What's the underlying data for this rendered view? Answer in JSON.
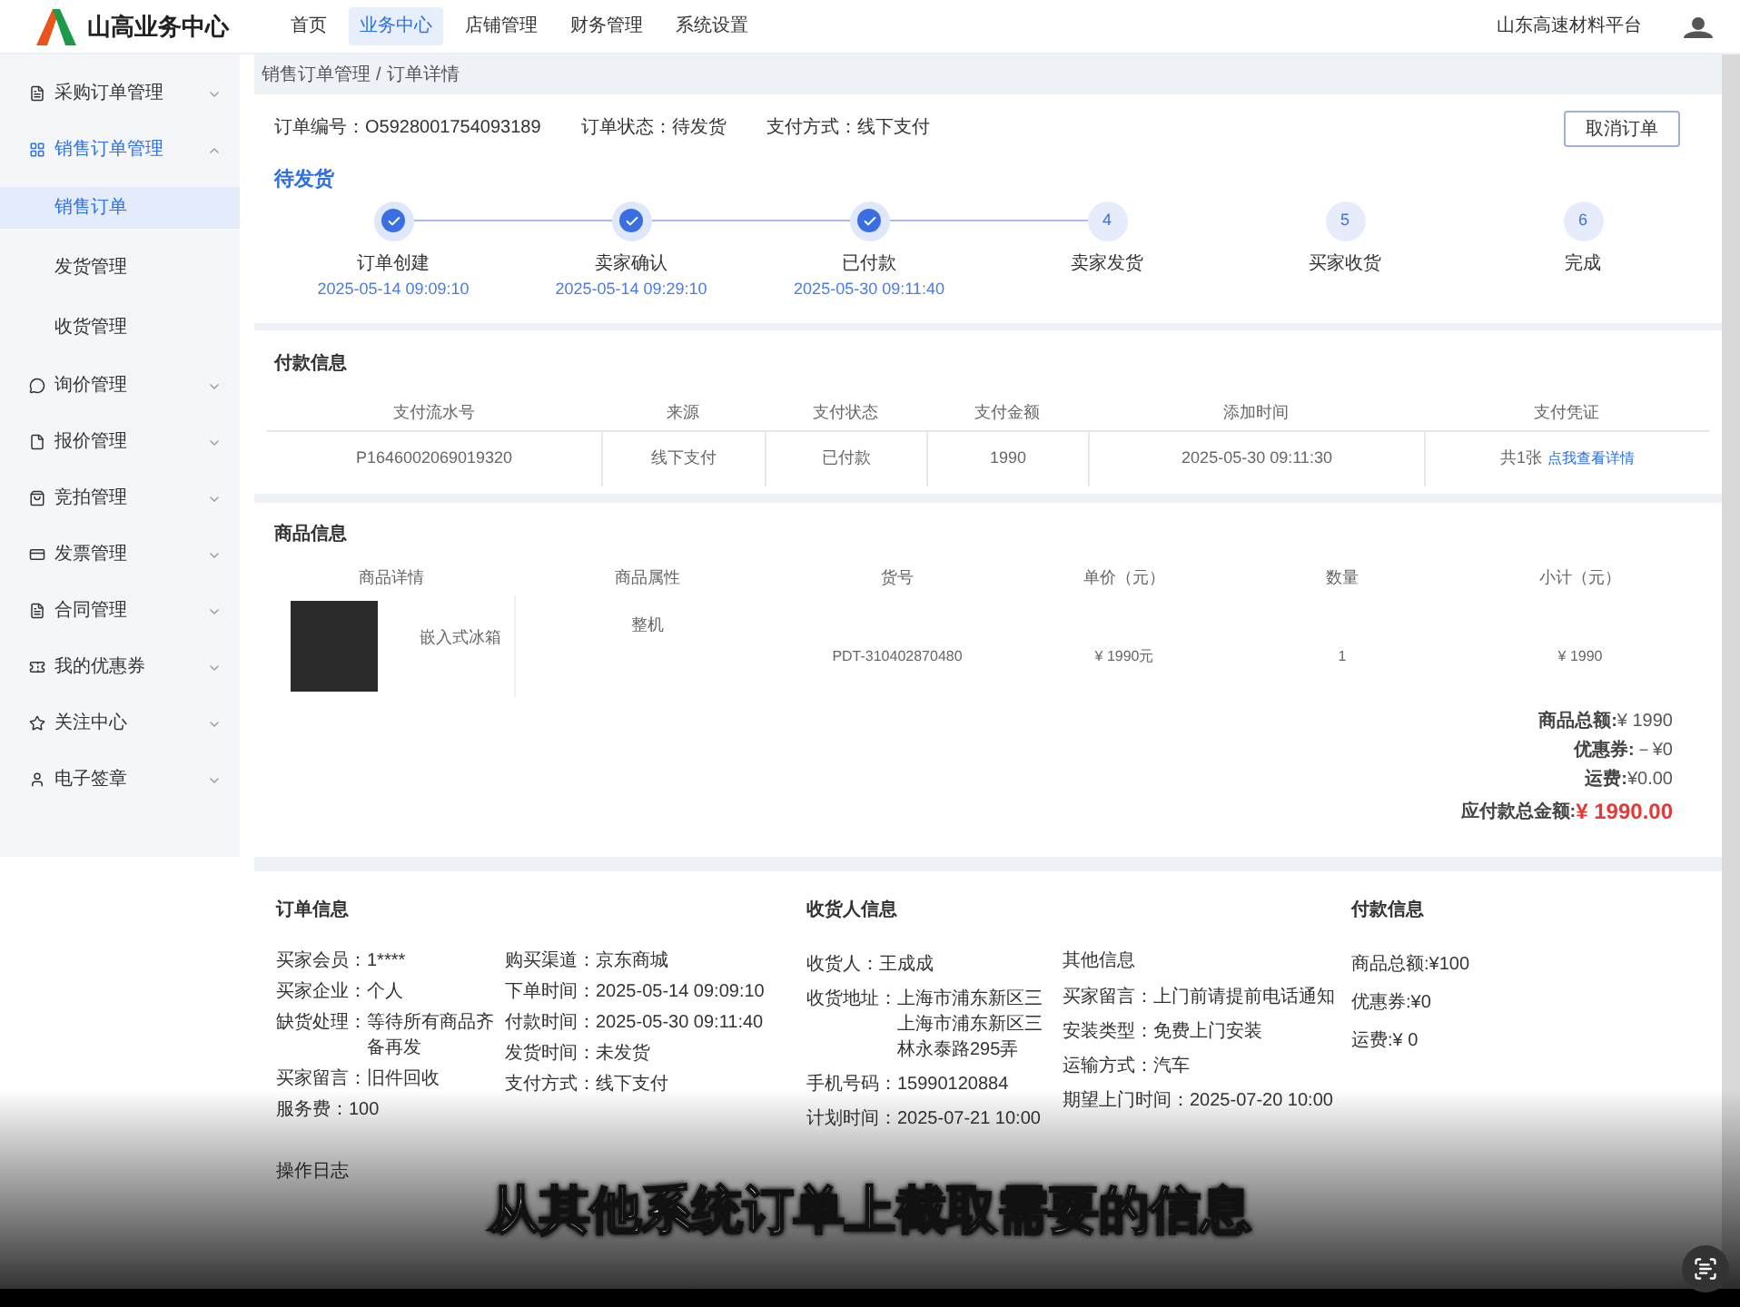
{
  "header": {
    "title": "山高业务中心",
    "nav": [
      {
        "label": "首页",
        "selected": false
      },
      {
        "label": "业务中心",
        "selected": true
      },
      {
        "label": "店铺管理",
        "selected": false
      },
      {
        "label": "财务管理",
        "selected": false
      },
      {
        "label": "系统设置",
        "selected": false
      }
    ],
    "platform": "山东高速材料平台"
  },
  "sidebar": {
    "items": [
      {
        "label": "采购订单管理",
        "selected": false,
        "expanded": false
      },
      {
        "label": "销售订单管理",
        "selected": true,
        "expanded": true,
        "children": [
          {
            "label": "销售订单",
            "selected": true
          },
          {
            "label": "发货管理",
            "selected": false
          },
          {
            "label": "收货管理",
            "selected": false
          }
        ]
      },
      {
        "label": "询价管理",
        "selected": false,
        "expanded": false
      },
      {
        "label": "报价管理",
        "selected": false,
        "expanded": false
      },
      {
        "label": "竞拍管理",
        "selected": false,
        "expanded": false
      },
      {
        "label": "发票管理",
        "selected": false,
        "expanded": false
      },
      {
        "label": "合同管理",
        "selected": false,
        "expanded": false
      },
      {
        "label": "我的优惠券",
        "selected": false,
        "expanded": false
      },
      {
        "label": "关注中心",
        "selected": false,
        "expanded": false
      },
      {
        "label": "电子签章",
        "selected": false,
        "expanded": false
      }
    ]
  },
  "breadcrumb": [
    "销售订单管理",
    "/",
    "订单详情"
  ],
  "order_header": {
    "fields": [
      {
        "label": "订单编号：",
        "value": "O5928001754093189"
      },
      {
        "label": "订单状态：",
        "value": "待发货"
      },
      {
        "label": "支付方式：",
        "value": "线下支付"
      }
    ],
    "cancel_button": "取消订单",
    "status": "待发货",
    "steps": [
      {
        "label": "订单创建",
        "time": "2025-05-14 09:09:10",
        "done": true
      },
      {
        "label": "卖家确认",
        "time": "2025-05-14 09:29:10",
        "done": true
      },
      {
        "label": "已付款",
        "time": "2025-05-30 09:11:40",
        "done": true
      },
      {
        "number": "4",
        "label": "卖家发货",
        "done": false
      },
      {
        "number": "5",
        "label": "买家收货",
        "done": false
      },
      {
        "number": "6",
        "label": "完成",
        "done": false
      }
    ]
  },
  "payment": {
    "title": "付款信息",
    "columns": [
      "支付流水号",
      "来源",
      "支付状态",
      "支付金额",
      "添加时间",
      "支付凭证"
    ],
    "rows": [
      {
        "cells": [
          "P1646002069019320",
          "线下支付",
          "已付款",
          "1990",
          "2025-05-30 09:11:30"
        ],
        "voucher": "共1张",
        "voucher_link": "点我查看详情"
      }
    ]
  },
  "goods": {
    "title": "商品信息",
    "columns": [
      "商品详情",
      "商品属性",
      "货号",
      "单价（元）",
      "数量",
      "小计（元）"
    ],
    "rows": [
      {
        "name": "嵌入式冰箱",
        "attribute": "整机",
        "sku": "PDT-310402870480",
        "price": "¥ 1990元",
        "quantity": "1",
        "subtotal": "¥ 1990"
      }
    ],
    "totals": [
      {
        "label": "商品总额:",
        "value": "¥ 1990",
        "kind": "normal"
      },
      {
        "label": "优惠券:",
        "value": "－¥0",
        "kind": "normal"
      },
      {
        "label": "运费:",
        "value": "¥0.00",
        "kind": "normal"
      },
      {
        "label": "应付款总金额:",
        "value": "¥ 1990.00",
        "kind": "grand"
      }
    ]
  },
  "order_info": {
    "title": "订单信息",
    "columns": [
      [
        {
          "label": "买家会员：",
          "value": "1****"
        },
        {
          "label": "买家企业：",
          "value": "个人"
        },
        {
          "label": "缺货处理：",
          "value": "等待所有商品齐备再发"
        },
        {
          "label": "买家留言：",
          "value": "旧件回收"
        },
        {
          "label": "服务费：",
          "value": "100"
        }
      ],
      [
        {
          "label": "购买渠道：",
          "value": "京东商城"
        },
        {
          "label": "下单时间：",
          "value": "2025-05-14 09:09:10"
        },
        {
          "label": "付款时间：",
          "value": "2025-05-30 09:11:40"
        },
        {
          "label": "发货时间：",
          "value": "未发货"
        },
        {
          "label": "支付方式：",
          "value": "线下支付"
        }
      ]
    ]
  },
  "receiver_info": {
    "title": "收货人信息",
    "fields": [
      {
        "label": "收货人：",
        "value": "王成成"
      },
      {
        "label": "收货地址：",
        "value": "上海市浦东新区三上海市浦东新区三林永泰路295弄"
      },
      {
        "label": "手机号码：",
        "value": "15990120884"
      },
      {
        "label": "计划时间：",
        "value": "2025-07-21 10:00"
      }
    ],
    "other": {
      "title": "其他信息",
      "fields": [
        {
          "label": "买家留言：",
          "value": "上门前请提前电话通知"
        },
        {
          "label": "安装类型：",
          "value": "免费上门安装"
        },
        {
          "label": "运输方式：",
          "value": "汽车"
        },
        {
          "label": "期望上门时间：",
          "value": "2025-07-20 10:00"
        }
      ]
    }
  },
  "payment_summary": {
    "title": "付款信息",
    "fields": [
      {
        "label": "商品总额:",
        "value": "¥100"
      },
      {
        "label": "优惠券:",
        "value": "¥0"
      },
      {
        "label": "运费:",
        "value": "¥ 0"
      }
    ]
  },
  "operation_log": {
    "title": "操作日志"
  },
  "subtitle": "从其他系统订单上截取需要的信息"
}
